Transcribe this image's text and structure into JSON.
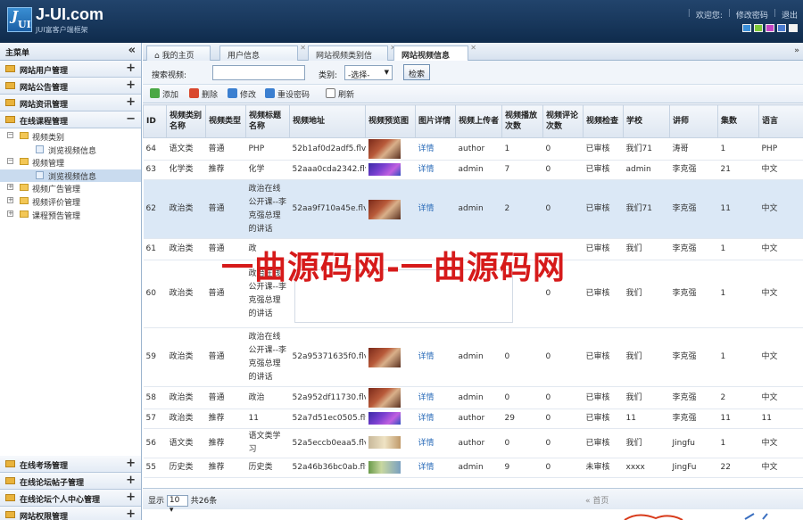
{
  "header": {
    "logo_icon": "JUI",
    "title": "J-UI.com",
    "subtitle": "JUI富客户端框架",
    "links": [
      "欢迎您:",
      "修改密码",
      "退出"
    ],
    "theme_colors": [
      "#3b8fd8",
      "#7ec83a",
      "#c545c5",
      "#4a7bd0",
      "#f2f2f2"
    ]
  },
  "sidebar": {
    "title": "主菜单",
    "collapse_symbol": "«",
    "top_groups": [
      {
        "label": "网站用户管理",
        "toggle": "+"
      },
      {
        "label": "网站公告管理",
        "toggle": "+"
      },
      {
        "label": "网站资讯管理",
        "toggle": "+"
      },
      {
        "label": "在线课程管理",
        "toggle": "−"
      }
    ],
    "tree": [
      {
        "label": "视频类别",
        "toggle": "⊟"
      },
      {
        "label": "浏览视频信息"
      },
      {
        "label": "视频管理",
        "toggle": "⊟"
      },
      {
        "label": "浏览视频信息"
      },
      {
        "label": "视频广告管理",
        "toggle": "⊞"
      },
      {
        "label": "视频评价管理",
        "toggle": "⊞"
      },
      {
        "label": "课程预告管理",
        "toggle": "⊞"
      }
    ],
    "bottom_groups": [
      {
        "label": "在线考场管理",
        "toggle": "+"
      },
      {
        "label": "在线论坛帖子管理",
        "toggle": "+"
      },
      {
        "label": "在线论坛个人中心管理",
        "toggle": "+"
      },
      {
        "label": "网站权限管理",
        "toggle": "+"
      }
    ]
  },
  "tabs": {
    "home": "我的主页",
    "items": [
      "用户信息",
      "网站视频类别信",
      "网站视频信息"
    ],
    "more": "»"
  },
  "search": {
    "label": "搜索视频:",
    "value": "",
    "category_label": "类别:",
    "category_selected": "-选择-",
    "button": "检索"
  },
  "toolbar": {
    "add": "添加",
    "delete": "删除",
    "edit": "修改",
    "reset_password": "重设密码",
    "refresh": "刷新"
  },
  "table": {
    "headers": [
      "ID",
      "视频类别名称",
      "视频类型",
      "视频标题名称",
      "视频地址",
      "视频预览图",
      "图片详情",
      "视频上传者",
      "视频播放次数",
      "视频评论次数",
      "视频检查",
      "学校",
      "讲师",
      "集数",
      "语言"
    ],
    "rows": [
      {
        "id": "64",
        "cat": "语文类",
        "type": "普通",
        "title": "PHP",
        "url": "52b1af0d2adf5.flv",
        "thumb": "red",
        "detail": "详情",
        "uploader": "author",
        "plays": "1",
        "comments": "0",
        "check": "已审核",
        "school": "我们71",
        "teacher": "涛哥",
        "eps": "1",
        "lang": "PHP"
      },
      {
        "id": "63",
        "cat": "化学类",
        "type": "推荐",
        "title": "化学",
        "url": "52aaa0cda2342.flv",
        "thumb": "purple",
        "detail": "详情",
        "uploader": "admin",
        "plays": "7",
        "comments": "0",
        "check": "已审核",
        "school": "admin",
        "teacher": "李克强",
        "eps": "21",
        "lang": "中文"
      },
      {
        "id": "62",
        "cat": "政治类",
        "type": "普通",
        "title": "政治在线公开课--李克强总理的讲话",
        "url": "52aa9f710a45e.flv",
        "thumb": "red",
        "detail": "详情",
        "uploader": "admin",
        "plays": "2",
        "comments": "0",
        "check": "已审核",
        "school": "我们71",
        "teacher": "李克强",
        "eps": "11",
        "lang": "中文"
      },
      {
        "id": "61",
        "cat": "政治类",
        "type": "普通",
        "title": "政",
        "url": "",
        "thumb": "",
        "detail": "",
        "uploader": "",
        "plays": "",
        "comments": "",
        "check": "已审核",
        "school": "我们",
        "teacher": "李克强",
        "eps": "1",
        "lang": "中文"
      },
      {
        "id": "60",
        "cat": "政治类",
        "type": "普通",
        "title": "政治在线公开课--李克强总理的讲话",
        "url": "",
        "thumb": "",
        "detail": "",
        "uploader": "",
        "plays": "",
        "comments": "0",
        "check": "已审核",
        "school": "我们",
        "teacher": "李克强",
        "eps": "1",
        "lang": "中文"
      },
      {
        "id": "59",
        "cat": "政治类",
        "type": "普通",
        "title": "政治在线公开课--李克强总理的讲话",
        "url": "52a95371635f0.flv",
        "thumb": "red",
        "detail": "详情",
        "uploader": "admin",
        "plays": "0",
        "comments": "0",
        "check": "已审核",
        "school": "我们",
        "teacher": "李克强",
        "eps": "1",
        "lang": "中文"
      },
      {
        "id": "58",
        "cat": "政治类",
        "type": "普通",
        "title": "政治",
        "url": "52a952df11730.flv",
        "thumb": "red",
        "detail": "详情",
        "uploader": "admin",
        "plays": "0",
        "comments": "0",
        "check": "已审核",
        "school": "我们",
        "teacher": "李克强",
        "eps": "2",
        "lang": "中文"
      },
      {
        "id": "57",
        "cat": "政治类",
        "type": "推荐",
        "title": "11",
        "url": "52a7d51ec0505.flv",
        "thumb": "purple",
        "detail": "详情",
        "uploader": "author",
        "plays": "29",
        "comments": "0",
        "check": "已审核",
        "school": "11",
        "teacher": "李克强",
        "eps": "11",
        "lang": "11"
      },
      {
        "id": "56",
        "cat": "语文类",
        "type": "推荐",
        "title": "语文类学习",
        "url": "52a5eccb0eaa5.flv",
        "thumb": "beige",
        "detail": "详情",
        "uploader": "author",
        "plays": "0",
        "comments": "0",
        "check": "已审核",
        "school": "我们",
        "teacher": "Jingfu",
        "eps": "1",
        "lang": "中文"
      },
      {
        "id": "55",
        "cat": "历史类",
        "type": "推荐",
        "title": "历史类",
        "url": "52a46b36bc0ab.flv",
        "thumb": "green",
        "detail": "详情",
        "uploader": "admin",
        "plays": "9",
        "comments": "0",
        "check": "未审核",
        "school": "xxxx",
        "teacher": "JingFu",
        "eps": "22",
        "lang": "中文"
      }
    ]
  },
  "pager": {
    "show_label": "显示",
    "page_size": "10",
    "total": "共26条",
    "first": "« 首页"
  },
  "watermark": "一曲源码网-一曲源码网"
}
